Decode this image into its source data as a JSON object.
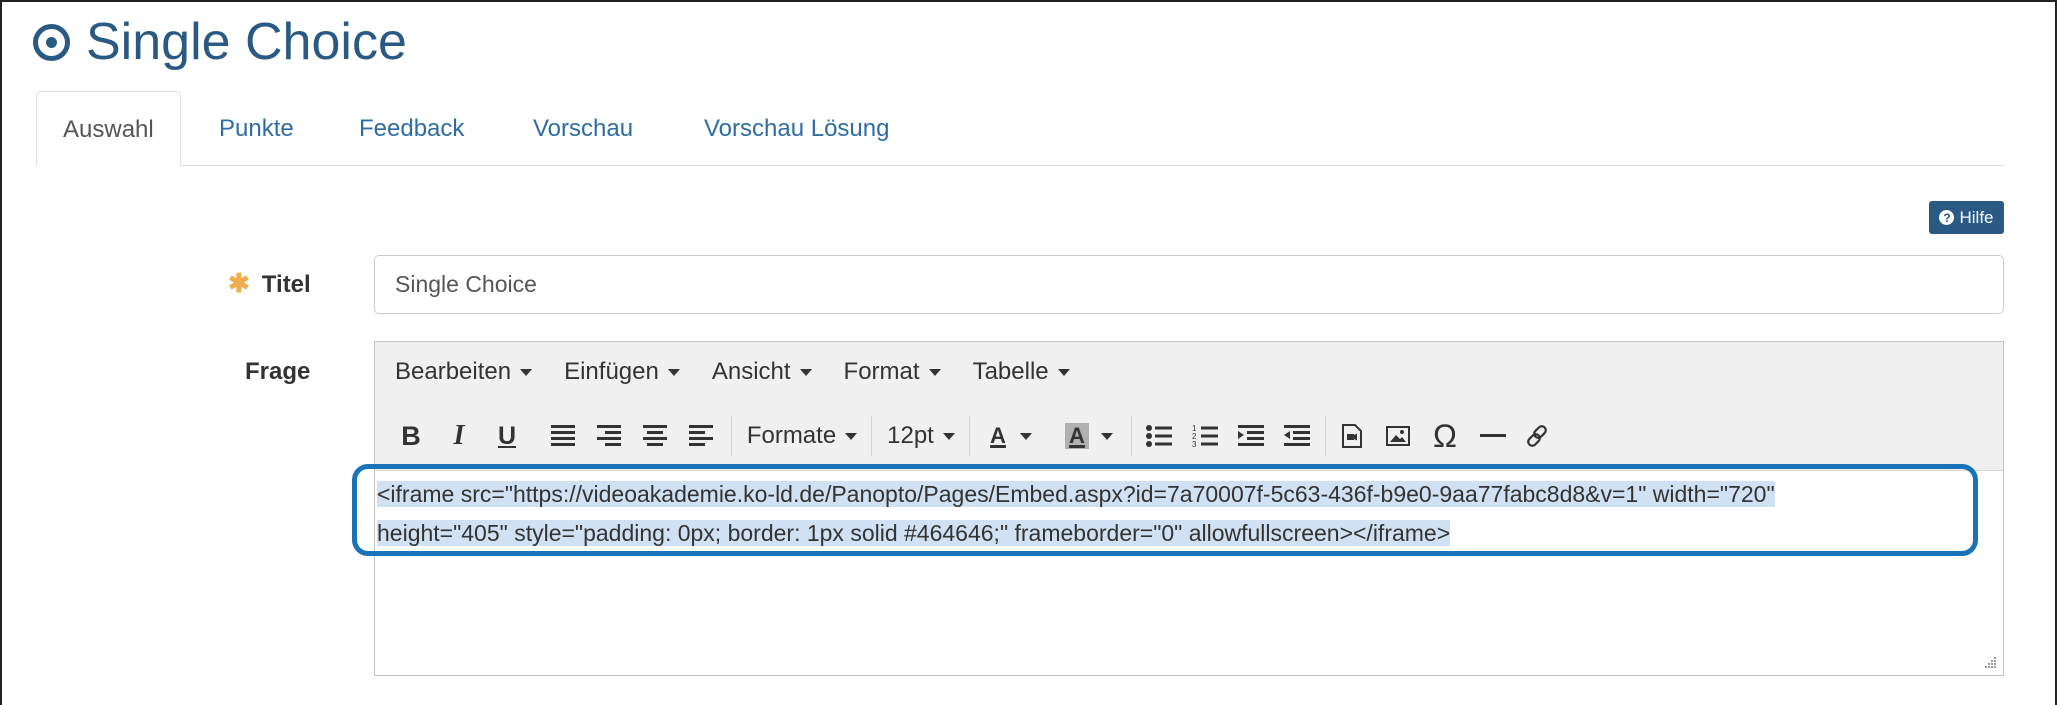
{
  "page": {
    "title": "Single Choice"
  },
  "tabs": [
    {
      "label": "Auswahl"
    },
    {
      "label": "Punkte"
    },
    {
      "label": "Feedback"
    },
    {
      "label": "Vorschau"
    },
    {
      "label": "Vorschau Lösung"
    }
  ],
  "help": {
    "label": "Hilfe",
    "icon": "question-circle-icon"
  },
  "form": {
    "title_label": "Titel",
    "title_value": "Single Choice",
    "question_label": "Frage"
  },
  "editor": {
    "menus": [
      {
        "label": "Bearbeiten"
      },
      {
        "label": "Einfügen"
      },
      {
        "label": "Ansicht"
      },
      {
        "label": "Format"
      },
      {
        "label": "Tabelle"
      }
    ],
    "toolbar": {
      "bold": "B",
      "italic": "I",
      "underline": "U",
      "formats_label": "Formate",
      "font_size": "12pt",
      "text_color_label": "A",
      "bg_color_label": "A",
      "special_char": "Ω"
    },
    "content_line1": "<iframe src=\"https://videoakademie.ko-ld.de/Panopto/Pages/Embed.aspx?id=7a70007f-5c63-436f-b9e0-9aa77fabc8d8&v=1\" width=\"720\"",
    "content_line2": "height=\"405\" style=\"padding: 0px; border: 1px solid #464646;\" frameborder=\"0\" allowfullscreen></iframe>"
  },
  "colors": {
    "accent": "#2a5a84",
    "link": "#2e6da4",
    "required": "#f0ad4e",
    "highlight_border": "#1a73b8",
    "selection": "#cfe1f3"
  }
}
